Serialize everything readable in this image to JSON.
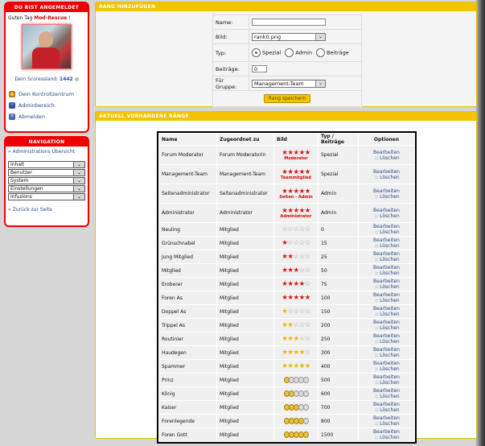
{
  "login_box": {
    "title": "DU BIST ANGEMELDET",
    "greeting_prefix": "Guten Tag ",
    "username": "Mod-Rescue",
    "greeting_suffix": " !",
    "score_label": "Dein Scoressland:",
    "score_value": "1442",
    "links": [
      {
        "label": "Dein Kontrollzentrum",
        "icon": "control-panel-icon"
      },
      {
        "label": "Adminbereich",
        "icon": "admin-user-icon"
      },
      {
        "label": "Abmelden",
        "icon": "logout-icon"
      }
    ]
  },
  "nav_box": {
    "title": "NAVIGATION",
    "overview_link": "Administrations Übersicht",
    "dropdowns": [
      "Inhalt",
      "Benutzer",
      "System",
      "Einstellungen",
      "Infusions"
    ],
    "back_link": "Zurück zur Seite"
  },
  "add_rank": {
    "title": "RANG HINZUFÜGEN",
    "name_label": "Name:",
    "name_value": "",
    "image_label": "Bild:",
    "image_value": "rank0.png",
    "type_label": "Typ:",
    "type_options": [
      "Spezial",
      "Admin",
      "Beiträge"
    ],
    "type_selected": "Spezial",
    "posts_label": "Beiträge:",
    "posts_value": "0",
    "group_label": "Für Gruppe:",
    "group_value": "Management-Team",
    "save_label": "Rang speichern"
  },
  "current_ranks": {
    "title": "AKTUELL VORHANDENE RÄNGE",
    "headers": [
      "Name",
      "Zugeordnet zu",
      "Bild",
      "Typ / Beiträge",
      "Optionen"
    ],
    "edit_label": "Bearbeiten",
    "sep": " :: ",
    "delete_label": "Löschen",
    "rows": [
      {
        "name": "Forum Moderator",
        "group": "Forum Moderatorin",
        "image": {
          "kind": "stars",
          "filled": 5,
          "color": "#d01818",
          "sub": "Moderator"
        },
        "type": "Spezial"
      },
      {
        "name": "Management-Team",
        "group": "Management-Team",
        "image": {
          "kind": "stars",
          "filled": 5,
          "color": "#d01818",
          "sub": "Teammitglied"
        },
        "type": "Spezial"
      },
      {
        "name": "Seitenadministrator",
        "group": "Seitenadministrator",
        "image": {
          "kind": "stars",
          "filled": 5,
          "color": "#d01818",
          "sub": "Seiten - Admin"
        },
        "type": "Admin"
      },
      {
        "name": "Administrator",
        "group": "Administrator",
        "image": {
          "kind": "stars",
          "filled": 5,
          "color": "#d01818",
          "sub": "Administrator"
        },
        "type": "Admin"
      },
      {
        "name": "Neuling",
        "group": "Mitglied",
        "image": {
          "kind": "stars",
          "filled": 0,
          "color": "#d01818",
          "sub": ""
        },
        "type": "0"
      },
      {
        "name": "Grünschnabel",
        "group": "Mitglied",
        "image": {
          "kind": "stars",
          "filled": 1,
          "color": "#d01818",
          "sub": ""
        },
        "type": "15"
      },
      {
        "name": "Jung Mitglied",
        "group": "Mitglied",
        "image": {
          "kind": "stars",
          "filled": 2,
          "color": "#d01818",
          "sub": ""
        },
        "type": "25"
      },
      {
        "name": "Mitglied",
        "group": "Mitglied",
        "image": {
          "kind": "stars",
          "filled": 3,
          "color": "#d01818",
          "sub": ""
        },
        "type": "50"
      },
      {
        "name": "Eroberer",
        "group": "Mitglied",
        "image": {
          "kind": "stars",
          "filled": 4,
          "color": "#d01818",
          "sub": ""
        },
        "type": "75"
      },
      {
        "name": "Foren As",
        "group": "Mitglied",
        "image": {
          "kind": "stars",
          "filled": 5,
          "color": "#d01818",
          "sub": ""
        },
        "type": "100"
      },
      {
        "name": "Doppel As",
        "group": "Mitglied",
        "image": {
          "kind": "stars",
          "filled": 1,
          "color": "#e6b800",
          "sub": ""
        },
        "type": "150"
      },
      {
        "name": "Trippel As",
        "group": "Mitglied",
        "image": {
          "kind": "stars",
          "filled": 2,
          "color": "#e6b800",
          "sub": ""
        },
        "type": "200"
      },
      {
        "name": "Routinier",
        "group": "Mitglied",
        "image": {
          "kind": "stars",
          "filled": 3,
          "color": "#e6b800",
          "sub": ""
        },
        "type": "250"
      },
      {
        "name": "Haudegen",
        "group": "Mitglied",
        "image": {
          "kind": "stars",
          "filled": 4,
          "color": "#e6b800",
          "sub": ""
        },
        "type": "300"
      },
      {
        "name": "Spammer",
        "group": "Mitglied",
        "image": {
          "kind": "stars",
          "filled": 5,
          "color": "#e6b800",
          "sub": ""
        },
        "type": "400"
      },
      {
        "name": "Prinz",
        "group": "Mitglied",
        "image": {
          "kind": "coins",
          "filled": 1
        },
        "type": "500"
      },
      {
        "name": "König",
        "group": "Mitglied",
        "image": {
          "kind": "coins",
          "filled": 2
        },
        "type": "600"
      },
      {
        "name": "Kaiser",
        "group": "Mitglied",
        "image": {
          "kind": "coins",
          "filled": 3
        },
        "type": "700"
      },
      {
        "name": "Forenlegende",
        "group": "Mitglied",
        "image": {
          "kind": "coins",
          "filled": 4
        },
        "type": "800"
      },
      {
        "name": "Foren Gott",
        "group": "Mitglied",
        "image": {
          "kind": "coins",
          "filled": 5
        },
        "type": "1500"
      }
    ]
  }
}
